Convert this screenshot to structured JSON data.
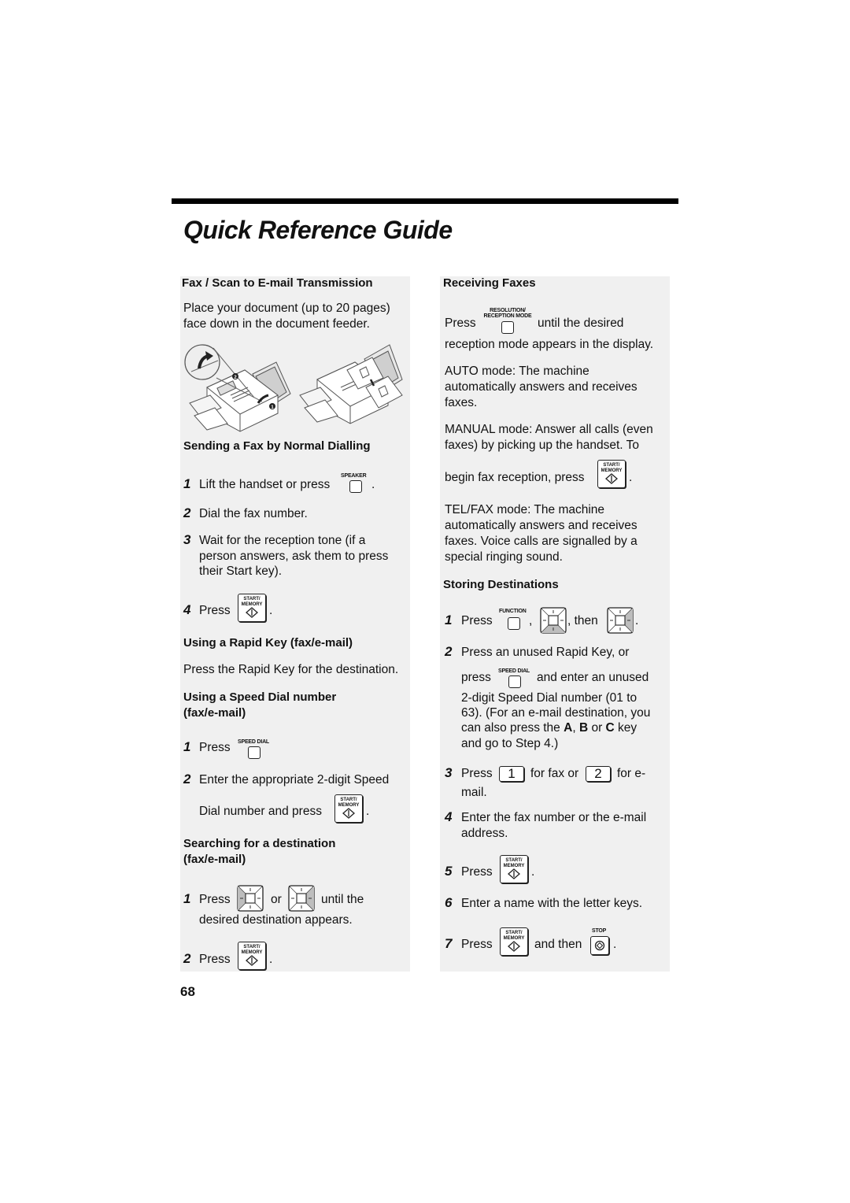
{
  "page": {
    "title": "Quick Reference Guide",
    "page_number": "68"
  },
  "left": {
    "fax_scan": {
      "heading": "Fax / Scan to E-mail Transmission",
      "text_line1": "Place your document (up to 20 pages)",
      "text_line2": "face down in the document feeder.",
      "callout_1": "1",
      "callout_2": "2"
    },
    "normal_dialling": {
      "heading": "Sending a Fax by Normal Dialling",
      "steps": [
        {
          "n": "1",
          "text": "Lift the handset or press",
          "key": "SPEAKER",
          "after": "."
        },
        {
          "n": "2",
          "text": "Dial the fax number."
        },
        {
          "n": "3",
          "line1": "Wait for the reception tone (if a",
          "line2": "person answers, ask them to press",
          "line3": "their Start key)."
        },
        {
          "n": "4",
          "text": "Press",
          "after": "."
        }
      ]
    },
    "rapid_key": {
      "heading": "Using a Rapid Key (fax/e-mail)",
      "text": "Press the Rapid Key for the destination."
    },
    "speed_dial": {
      "heading_line1": "Using a Speed Dial number",
      "heading_line2": "(fax/e-mail)",
      "steps": [
        {
          "n": "1",
          "text": "Press",
          "key": "SPEED DIAL"
        },
        {
          "n": "2",
          "line1": "Enter the appropriate 2-digit Speed",
          "line2": "Dial number and press",
          "after": "."
        }
      ]
    },
    "search": {
      "heading_line1": "Searching for a destination",
      "heading_line2": "(fax/e-mail)",
      "steps": [
        {
          "n": "1",
          "text": "Press",
          "or": "or",
          "until": "until the",
          "line2": "desired destination appears."
        },
        {
          "n": "2",
          "text": "Press",
          "after": "."
        }
      ]
    }
  },
  "right": {
    "receiving": {
      "heading": "Receiving Faxes",
      "press": "Press",
      "key_line1": "RESOLUTION/",
      "key_line2": "RECEPTION MODE",
      "after_key": "until the desired",
      "line2": "reception mode appears in the display.",
      "auto_line1": "AUTO mode: The machine",
      "auto_line2": "automatically answers and receives",
      "auto_line3": "faxes.",
      "manual_line1": "MANUAL mode: Answer all calls (even",
      "manual_line2": "faxes) by picking up the handset. To",
      "manual_line3": "begin fax reception, press",
      "manual_after": ".",
      "telfax_line1": "TEL/FAX mode: The machine",
      "telfax_line2": "automatically answers and receives",
      "telfax_line3": "faxes. Voice calls are signalled by a",
      "telfax_line4": "special ringing sound."
    },
    "storing": {
      "heading": "Storing Destinations",
      "steps": [
        {
          "n": "1",
          "text": "Press",
          "key": "FUNCTION",
          "comma": ",",
          "then": ", then",
          "after": "."
        },
        {
          "n": "2",
          "line1": "Press an unused Rapid Key, or",
          "press": "press",
          "key": "SPEED DIAL",
          "after_key": "and enter an unused",
          "line3": "2-digit Speed Dial number (01 to",
          "line4": "63). (For an e-mail destination, you",
          "line5_a": "can also press the ",
          "key_a": "A",
          "sep1": ", ",
          "key_b": "B",
          "sep2": " or ",
          "key_c": "C",
          "line5_b": " key",
          "line6": "and go to Step 4.)"
        },
        {
          "n": "3",
          "text": "Press",
          "digit1": "1",
          "mid": "for fax or",
          "digit2": "2",
          "end": "for e-",
          "line2": "mail."
        },
        {
          "n": "4",
          "line1": "Enter the fax number or the e-mail",
          "line2": "address."
        },
        {
          "n": "5",
          "text": "Press",
          "after": "."
        },
        {
          "n": "6",
          "text": "Enter a name with the letter keys."
        },
        {
          "n": "7",
          "text": "Press",
          "and_then": "and then",
          "stop_key": "STOP",
          "after": "."
        }
      ]
    }
  },
  "keys": {
    "start_line1": "START/",
    "start_line2": "MEMORY"
  }
}
